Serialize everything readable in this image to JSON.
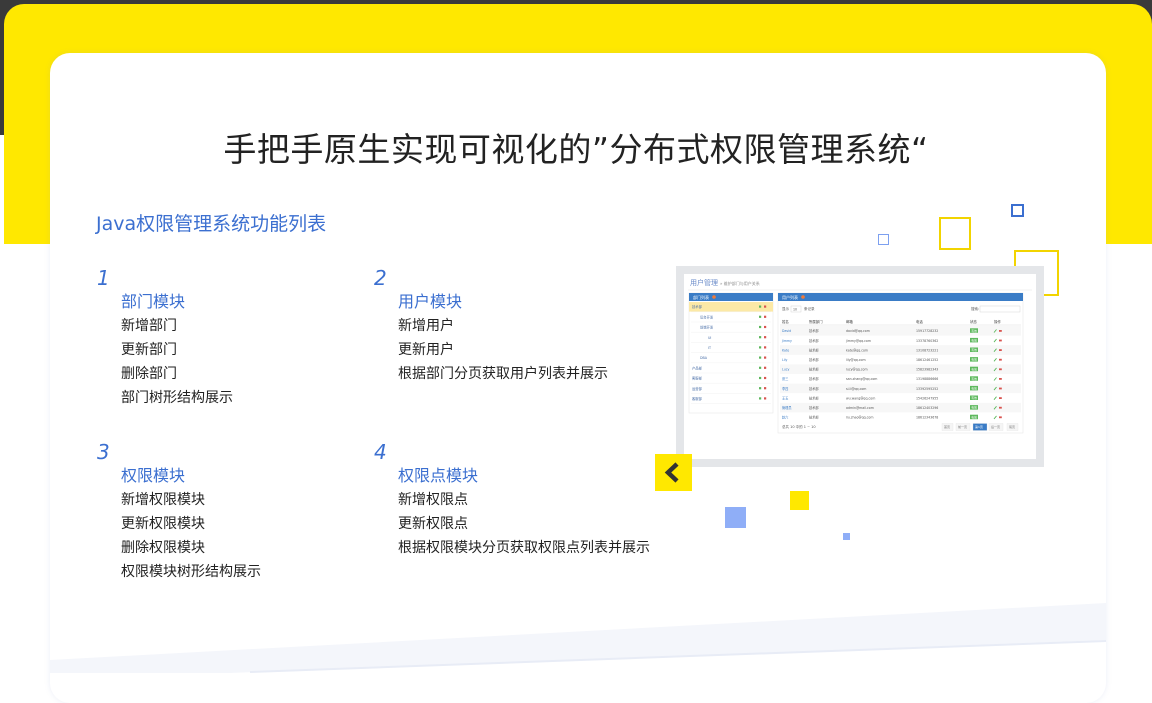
{
  "title": "手把手原生实现可视化的”分布式权限管理系统“",
  "subtitle": "Java权限管理系统功能列表",
  "modules": [
    {
      "num": "1",
      "name": "部门模块",
      "items": [
        "新增部门",
        "更新部门",
        "删除部门",
        "部门树形结构展示"
      ]
    },
    {
      "num": "2",
      "name": "用户模块",
      "items": [
        "新增用户",
        "更新用户",
        "根据部门分页获取用户列表并展示"
      ]
    },
    {
      "num": "3",
      "name": "权限模块",
      "items": [
        "新增权限模块",
        "更新权限模块",
        "删除权限模块",
        "权限模块树形结构展示"
      ]
    },
    {
      "num": "4",
      "name": "权限点模块",
      "items": [
        "新增权限点",
        "更新权限点",
        "根据权限模块分页获取权限点列表并展示"
      ]
    }
  ],
  "screenshot": {
    "header": "用户管理",
    "breadcrumb": "» 维护部门与用户关系",
    "dept_panel_title": "部门列表",
    "user_panel_title": "用户列表",
    "page_size_label": "显示",
    "page_size_value": "10",
    "page_size_suffix": "条记录",
    "search_label": "搜索:",
    "columns": [
      "姓名",
      "所属部门",
      "邮箱",
      "电话",
      "状态",
      "操作"
    ],
    "depts": [
      {
        "name": "技术部",
        "level": 0,
        "active": true
      },
      {
        "name": "后台开发",
        "level": 1,
        "active": false
      },
      {
        "name": "前端开发",
        "level": 1,
        "active": false
      },
      {
        "name": "UI",
        "level": 2,
        "active": false
      },
      {
        "name": "IT",
        "level": 2,
        "active": false
      },
      {
        "name": "DBA",
        "level": 1,
        "active": false
      },
      {
        "name": "产品部",
        "level": 0,
        "active": false
      },
      {
        "name": "客服部",
        "level": 0,
        "active": false
      },
      {
        "name": "运营部",
        "level": 0,
        "active": false
      },
      {
        "name": "客服部",
        "level": 0,
        "active": false
      }
    ],
    "rows": [
      {
        "name": "David",
        "dept": "技术部",
        "email": "david@qq.com",
        "phone": "15917728232",
        "status": "有效"
      },
      {
        "name": "Jimmy",
        "dept": "技术部",
        "email": "jimmy@qq.com",
        "phone": "13378760362",
        "status": "有效"
      },
      {
        "name": "Kate",
        "dept": "技术部",
        "email": "kate@qq.com",
        "phone": "13108723221",
        "status": "有效"
      },
      {
        "name": "Lily",
        "dept": "技术部",
        "email": "lily@qq.com",
        "phone": "18612461252",
        "status": "有效"
      },
      {
        "name": "Lucy",
        "dept": "技术部",
        "email": "lucy@qq.com",
        "phone": "15823982343",
        "status": "有效"
      },
      {
        "name": "张三",
        "dept": "技术部",
        "email": "san.zhang@qq.com",
        "phone": "13198886666",
        "status": "有效"
      },
      {
        "name": "李四",
        "dept": "技术部",
        "email": "si.li@qq.com",
        "phone": "13392595252",
        "status": "有效"
      },
      {
        "name": "王五",
        "dept": "技术部",
        "email": "wu.wang@qq.com",
        "phone": "15426247955",
        "status": "有效"
      },
      {
        "name": "管理员",
        "dept": "技术部",
        "email": "admin@mail.com",
        "phone": "18612403296",
        "status": "有效"
      },
      {
        "name": "赵六",
        "dept": "技术部",
        "email": "liu.zhao@qq.com",
        "phone": "18612343678",
        "status": "有效"
      }
    ],
    "footer_info": "总共 10 中的 1 ~ 10",
    "pager": [
      "首页",
      "前一页",
      "第1页",
      "后一页",
      "尾页"
    ]
  },
  "colors": {
    "accent_yellow": "#ffe800",
    "accent_blue": "#3b6fd0",
    "light_blue": "#8faef7"
  },
  "icons": {
    "collapse": "chevron-left-icon"
  }
}
